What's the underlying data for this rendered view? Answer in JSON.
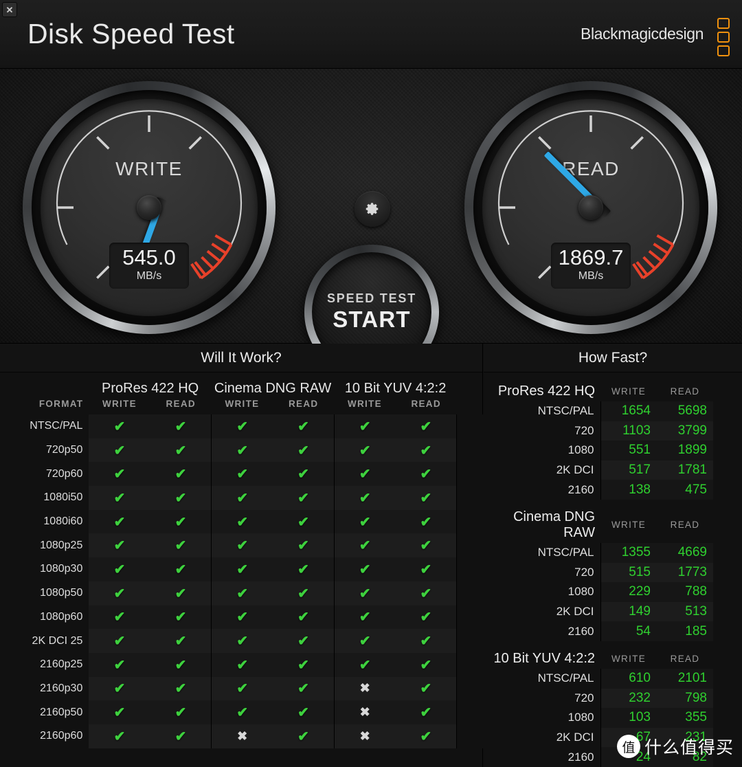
{
  "window": {
    "close_label": "✕",
    "title": "Disk Speed Test",
    "brand": "Blackmagicdesign"
  },
  "gauges": {
    "write": {
      "label": "WRITE",
      "value": "545.0",
      "unit": "MB/s",
      "needle_angle_deg": 200,
      "accent_color": "#2ea8e6"
    },
    "read": {
      "label": "READ",
      "value": "1869.7",
      "unit": "MB/s",
      "needle_angle_deg": 315,
      "accent_color": "#2ea8e6"
    },
    "redzone_color": "#e8412a",
    "tick_color": "#c9c9c9"
  },
  "controls": {
    "gear_icon": "gear-icon",
    "start_line1": "SPEED TEST",
    "start_line2": "START"
  },
  "will_it_work": {
    "title": "Will It Work?",
    "format_header": "FORMAT",
    "codecs": [
      "ProRes 422 HQ",
      "Cinema DNG RAW",
      "10 Bit YUV 4:2:2"
    ],
    "sub_headers": [
      "WRITE",
      "READ"
    ],
    "pass_glyph": "✔",
    "fail_glyph": "✖",
    "rows": [
      {
        "format": "NTSC/PAL",
        "cells": [
          true,
          true,
          true,
          true,
          true,
          true
        ]
      },
      {
        "format": "720p50",
        "cells": [
          true,
          true,
          true,
          true,
          true,
          true
        ]
      },
      {
        "format": "720p60",
        "cells": [
          true,
          true,
          true,
          true,
          true,
          true
        ]
      },
      {
        "format": "1080i50",
        "cells": [
          true,
          true,
          true,
          true,
          true,
          true
        ]
      },
      {
        "format": "1080i60",
        "cells": [
          true,
          true,
          true,
          true,
          true,
          true
        ]
      },
      {
        "format": "1080p25",
        "cells": [
          true,
          true,
          true,
          true,
          true,
          true
        ]
      },
      {
        "format": "1080p30",
        "cells": [
          true,
          true,
          true,
          true,
          true,
          true
        ]
      },
      {
        "format": "1080p50",
        "cells": [
          true,
          true,
          true,
          true,
          true,
          true
        ]
      },
      {
        "format": "1080p60",
        "cells": [
          true,
          true,
          true,
          true,
          true,
          true
        ]
      },
      {
        "format": "2K DCI 25",
        "cells": [
          true,
          true,
          true,
          true,
          true,
          true
        ]
      },
      {
        "format": "2160p25",
        "cells": [
          true,
          true,
          true,
          true,
          true,
          true
        ]
      },
      {
        "format": "2160p30",
        "cells": [
          true,
          true,
          true,
          true,
          false,
          true
        ]
      },
      {
        "format": "2160p50",
        "cells": [
          true,
          true,
          true,
          true,
          false,
          true
        ]
      },
      {
        "format": "2160p60",
        "cells": [
          true,
          true,
          false,
          true,
          false,
          true
        ]
      }
    ]
  },
  "how_fast": {
    "title": "How Fast?",
    "sub_headers": [
      "WRITE",
      "READ"
    ],
    "groups": [
      {
        "name": "ProRes 422 HQ",
        "rows": [
          {
            "label": "NTSC/PAL",
            "write": "1654",
            "read": "5698"
          },
          {
            "label": "720",
            "write": "1103",
            "read": "3799"
          },
          {
            "label": "1080",
            "write": "551",
            "read": "1899"
          },
          {
            "label": "2K DCI",
            "write": "517",
            "read": "1781"
          },
          {
            "label": "2160",
            "write": "138",
            "read": "475"
          }
        ]
      },
      {
        "name": "Cinema DNG RAW",
        "rows": [
          {
            "label": "NTSC/PAL",
            "write": "1355",
            "read": "4669"
          },
          {
            "label": "720",
            "write": "515",
            "read": "1773"
          },
          {
            "label": "1080",
            "write": "229",
            "read": "788"
          },
          {
            "label": "2K DCI",
            "write": "149",
            "read": "513"
          },
          {
            "label": "2160",
            "write": "54",
            "read": "185"
          }
        ]
      },
      {
        "name": "10 Bit YUV 4:2:2",
        "rows": [
          {
            "label": "NTSC/PAL",
            "write": "610",
            "read": "2101"
          },
          {
            "label": "720",
            "write": "232",
            "read": "798"
          },
          {
            "label": "1080",
            "write": "103",
            "read": "355"
          },
          {
            "label": "2K DCI",
            "write": "67",
            "read": "231"
          },
          {
            "label": "2160",
            "write": "24",
            "read": "82"
          }
        ]
      }
    ],
    "value_color": "#2fd02f"
  },
  "watermark": {
    "mark": "值",
    "text": "什么值得买"
  }
}
